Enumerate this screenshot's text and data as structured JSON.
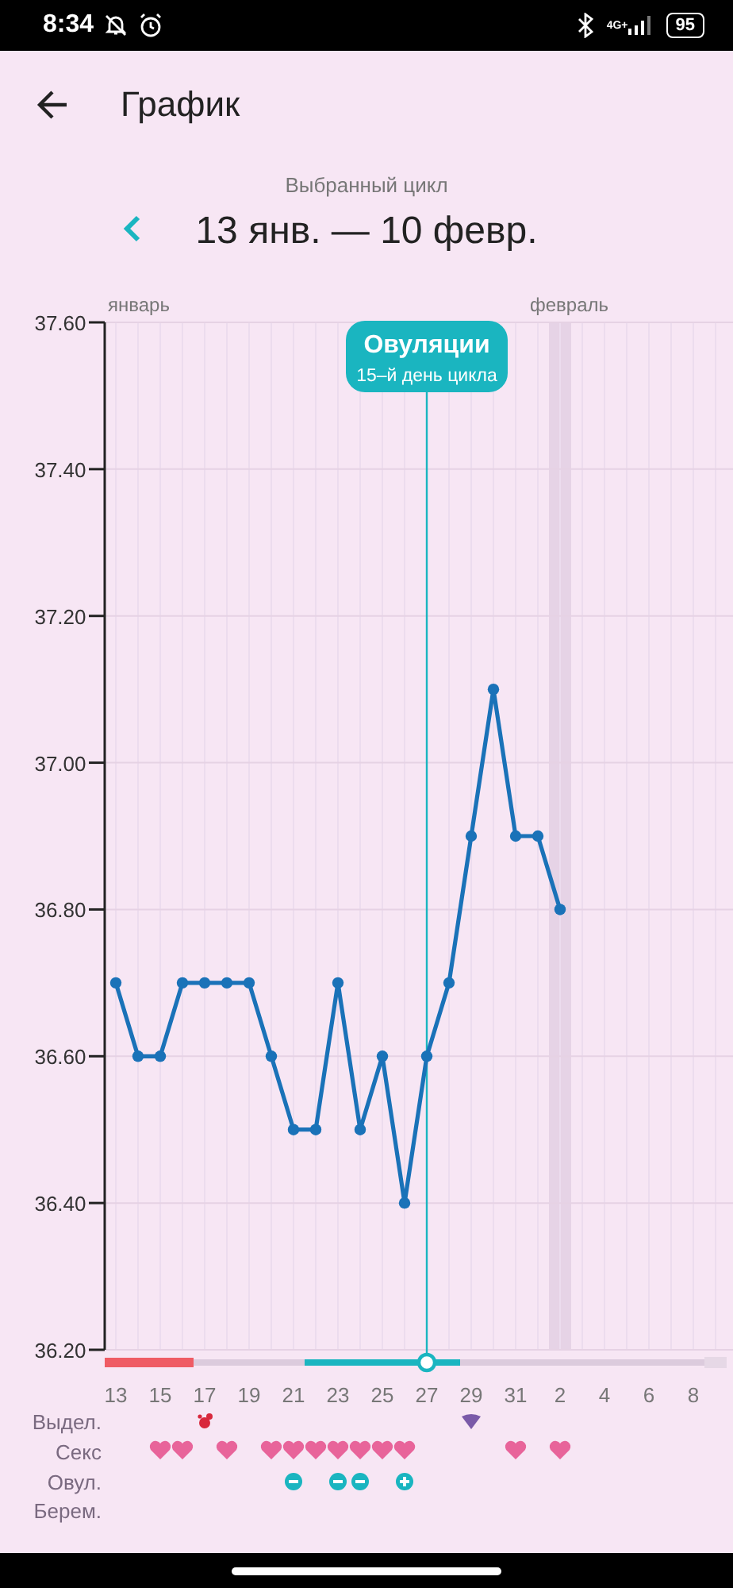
{
  "status_bar": {
    "time": "8:34",
    "network": "4G+",
    "battery": "95"
  },
  "header": {
    "title": "График"
  },
  "cycle": {
    "label": "Выбранный цикл",
    "range": "13 янв. — 10 февр."
  },
  "chart": {
    "ovulation_badge": {
      "title": "Овуляции",
      "subtitle": "15–й день цикла"
    },
    "days": [
      {
        "kind": "period",
        "month": "январь"
      },
      {
        "kind": "period"
      },
      {
        "kind": "period"
      },
      {
        "kind": "period"
      },
      {
        "kind": "none"
      },
      {
        "kind": "none"
      },
      {
        "kind": "none"
      },
      {
        "kind": "none"
      },
      {
        "kind": "none"
      },
      {
        "kind": "fertile"
      },
      {
        "kind": "fertile"
      },
      {
        "kind": "fertile"
      },
      {
        "kind": "fertile"
      },
      {
        "kind": "fertile"
      },
      {
        "kind": "ovulation"
      },
      {
        "kind": "fertile"
      },
      {
        "kind": "none"
      },
      {
        "kind": "none"
      },
      {
        "kind": "none"
      },
      {
        "kind": "none",
        "month": "февраль"
      },
      {
        "kind": "none",
        "today": true
      },
      {
        "kind": "none"
      },
      {
        "kind": "none"
      },
      {
        "kind": "none"
      },
      {
        "kind": "none"
      },
      {
        "kind": "none"
      },
      {
        "kind": "none"
      },
      {
        "kind": "predicted"
      }
    ],
    "chart_data": {
      "type": "line",
      "grid": true,
      "categories": [
        "13",
        null,
        "15",
        null,
        "17",
        null,
        "19",
        null,
        "21",
        null,
        "23",
        null,
        "25",
        null,
        "27",
        null,
        "29",
        null,
        "31",
        null,
        "2",
        null,
        "4",
        null,
        "6",
        null,
        "8",
        null
      ],
      "series": [
        {
          "color": "#1a72b8",
          "marker": "o",
          "values": [
            36.7,
            36.6,
            36.6,
            36.7,
            36.7,
            36.7,
            36.7,
            36.6,
            36.5,
            36.5,
            36.7,
            36.5,
            36.6,
            36.4,
            36.6,
            36.7,
            36.9,
            37.1,
            36.9,
            36.9,
            36.8,
            null,
            null,
            null,
            null,
            null,
            null,
            null
          ]
        }
      ],
      "ylim": [
        36.2,
        37.6
      ],
      "yticks": [
        {
          "value": 36.2,
          "label": "36.20"
        },
        {
          "value": 36.4,
          "label": "36.40"
        },
        {
          "value": 36.6,
          "label": "36.60"
        },
        {
          "value": 36.8,
          "label": "36.80"
        },
        {
          "value": 37.0,
          "label": "37.00"
        },
        {
          "value": 37.2,
          "label": "37.20"
        },
        {
          "value": 37.4,
          "label": "37.40"
        },
        {
          "value": 37.6,
          "label": "37.60"
        }
      ]
    }
  },
  "rows": [
    {
      "label": "Выдел.",
      "marks": [
        {
          "kind": "none"
        },
        {
          "kind": "none"
        },
        {
          "kind": "none"
        },
        {
          "kind": "none"
        },
        {
          "kind": "blood"
        },
        {
          "kind": "none"
        },
        {
          "kind": "none"
        },
        {
          "kind": "none"
        },
        {
          "kind": "none"
        },
        {
          "kind": "none"
        },
        {
          "kind": "none"
        },
        {
          "kind": "none"
        },
        {
          "kind": "none"
        },
        {
          "kind": "none"
        },
        {
          "kind": "none"
        },
        {
          "kind": "none"
        },
        {
          "kind": "drop"
        },
        {
          "kind": "none"
        },
        {
          "kind": "none"
        },
        {
          "kind": "none"
        },
        {
          "kind": "none"
        },
        {
          "kind": "none"
        },
        {
          "kind": "none"
        },
        {
          "kind": "none"
        },
        {
          "kind": "none"
        },
        {
          "kind": "none"
        },
        {
          "kind": "none"
        },
        {
          "kind": "none"
        }
      ]
    },
    {
      "label": "Секс",
      "marks": [
        {
          "kind": "none"
        },
        {
          "kind": "none"
        },
        {
          "kind": "heart"
        },
        {
          "kind": "heart"
        },
        {
          "kind": "none"
        },
        {
          "kind": "heart"
        },
        {
          "kind": "none"
        },
        {
          "kind": "heart"
        },
        {
          "kind": "heart"
        },
        {
          "kind": "heart"
        },
        {
          "kind": "heart"
        },
        {
          "kind": "heart"
        },
        {
          "kind": "heart"
        },
        {
          "kind": "heart"
        },
        {
          "kind": "none"
        },
        {
          "kind": "none"
        },
        {
          "kind": "none"
        },
        {
          "kind": "none"
        },
        {
          "kind": "heart"
        },
        {
          "kind": "none"
        },
        {
          "kind": "heart"
        },
        {
          "kind": "none"
        },
        {
          "kind": "none"
        },
        {
          "kind": "none"
        },
        {
          "kind": "none"
        },
        {
          "kind": "none"
        },
        {
          "kind": "none"
        },
        {
          "kind": "none"
        }
      ]
    },
    {
      "label": "Овул.",
      "marks": [
        {
          "kind": "none"
        },
        {
          "kind": "none"
        },
        {
          "kind": "none"
        },
        {
          "kind": "none"
        },
        {
          "kind": "none"
        },
        {
          "kind": "none"
        },
        {
          "kind": "none"
        },
        {
          "kind": "none"
        },
        {
          "kind": "minus"
        },
        {
          "kind": "none"
        },
        {
          "kind": "minus"
        },
        {
          "kind": "minus"
        },
        {
          "kind": "none"
        },
        {
          "kind": "plus"
        },
        {
          "kind": "none"
        },
        {
          "kind": "none"
        },
        {
          "kind": "none"
        },
        {
          "kind": "none"
        },
        {
          "kind": "none"
        },
        {
          "kind": "none"
        },
        {
          "kind": "none"
        },
        {
          "kind": "none"
        },
        {
          "kind": "none"
        },
        {
          "kind": "none"
        },
        {
          "kind": "none"
        },
        {
          "kind": "none"
        },
        {
          "kind": "none"
        },
        {
          "kind": "none"
        }
      ]
    },
    {
      "label": "Берем.",
      "marks": [
        {
          "kind": "none"
        },
        {
          "kind": "none"
        },
        {
          "kind": "none"
        },
        {
          "kind": "none"
        },
        {
          "kind": "none"
        },
        {
          "kind": "none"
        },
        {
          "kind": "none"
        },
        {
          "kind": "none"
        },
        {
          "kind": "none"
        },
        {
          "kind": "none"
        },
        {
          "kind": "none"
        },
        {
          "kind": "none"
        },
        {
          "kind": "none"
        },
        {
          "kind": "none"
        },
        {
          "kind": "none"
        },
        {
          "kind": "none"
        },
        {
          "kind": "none"
        },
        {
          "kind": "none"
        },
        {
          "kind": "none"
        },
        {
          "kind": "none"
        },
        {
          "kind": "none"
        },
        {
          "kind": "none"
        },
        {
          "kind": "none"
        },
        {
          "kind": "none"
        },
        {
          "kind": "none"
        },
        {
          "kind": "none"
        },
        {
          "kind": "none"
        },
        {
          "kind": "none"
        }
      ]
    }
  ]
}
